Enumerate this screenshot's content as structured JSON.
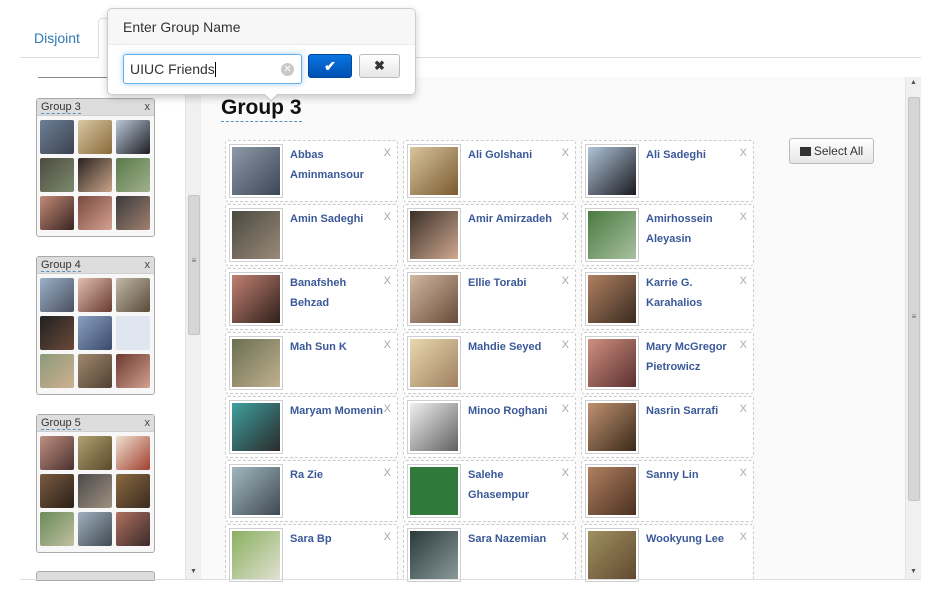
{
  "tabs": [
    {
      "label": "Disjoint"
    },
    {
      "label": ""
    }
  ],
  "popover": {
    "title": "Enter Group Name",
    "input_value": "UIUC Friends",
    "ok_icon": "checkmark-icon",
    "cancel_icon": "close-icon",
    "clear_icon": "clear-circle-icon"
  },
  "sidebar": {
    "groups": [
      {
        "label": "Group 3",
        "close": "x"
      },
      {
        "label": "Group 4",
        "close": "x"
      },
      {
        "label": "Group 5",
        "close": "x"
      }
    ]
  },
  "main": {
    "title": "Group 3",
    "select_all_label": "Select All",
    "select_all_icon": "table-icon",
    "remove_label": "X",
    "friends": [
      {
        "name": "Abbas Aminmansour"
      },
      {
        "name": "Ali Golshani"
      },
      {
        "name": "Ali Sadeghi"
      },
      {
        "name": "Amin Sadeghi"
      },
      {
        "name": "Amir Amirzadeh"
      },
      {
        "name": "Amirhossein Aleyasin"
      },
      {
        "name": "Banafsheh Behzad"
      },
      {
        "name": "Ellie Torabi"
      },
      {
        "name": "Karrie G. Karahalios"
      },
      {
        "name": "Mah Sun K"
      },
      {
        "name": "Mahdie Seyed"
      },
      {
        "name": "Mary McGregor Pietrowicz"
      },
      {
        "name": "Maryam Momenin"
      },
      {
        "name": "Minoo Roghani"
      },
      {
        "name": "Nasrin Sarrafi"
      },
      {
        "name": "Ra Zie"
      },
      {
        "name": "Salehe Ghasempur"
      },
      {
        "name": "Sanny Lin"
      },
      {
        "name": "Sara Bp"
      },
      {
        "name": "Sara Nazemian"
      },
      {
        "name": "Wookyung Lee"
      }
    ]
  },
  "colors": {
    "link": "#2f7ab5",
    "friend_name": "#3b5998",
    "ok_button": "#0a63c9"
  }
}
